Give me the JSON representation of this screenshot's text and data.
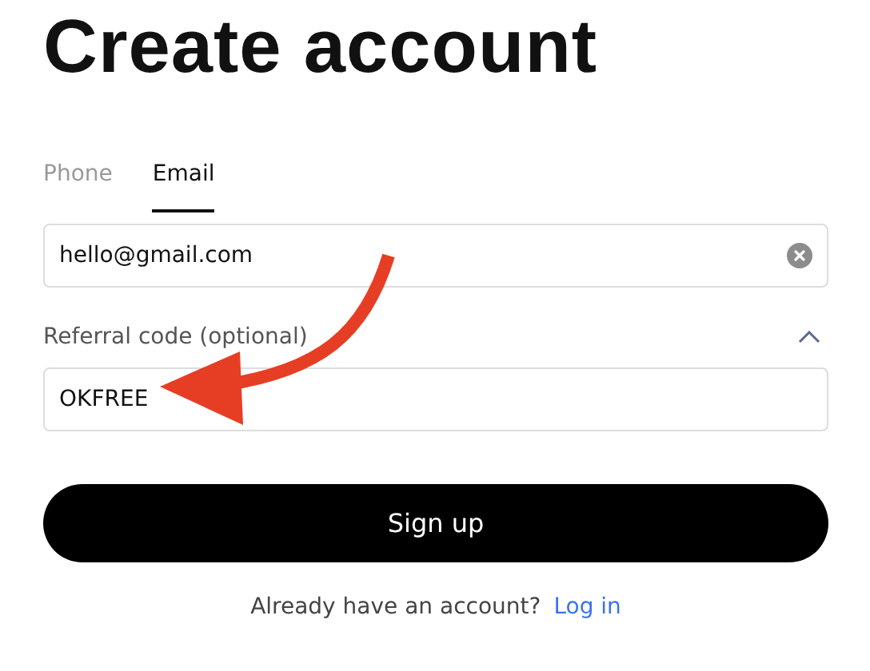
{
  "title": "Create account",
  "tabs": [
    {
      "label": "Phone",
      "selected": false
    },
    {
      "label": "Email",
      "selected": true
    }
  ],
  "email": {
    "value": "hello@gmail.com"
  },
  "referral": {
    "label": "Referral code (optional)",
    "expanded": true,
    "value": "OKFREE"
  },
  "submit": "Sign up",
  "footer": {
    "text": "Already have an account?",
    "link": "Log in"
  }
}
